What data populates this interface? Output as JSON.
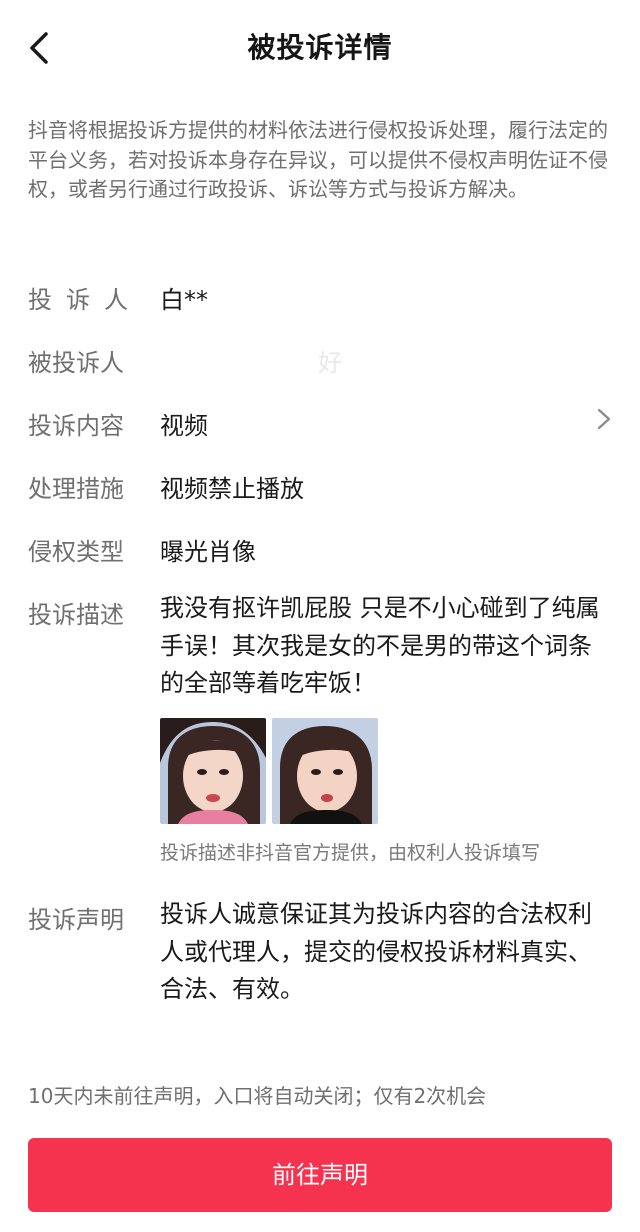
{
  "header": {
    "title": "被投诉详情",
    "back_icon": "chevron-left-icon"
  },
  "notice": "抖音将根据投诉方提供的材料依法进行侵权投诉处理，履行法定的平台义务，若对投诉本身存在异议，可以提供不侵权声明佐证不侵权，或者另行通过行政投诉、诉讼等方式与投诉方解决。",
  "rows": {
    "complainant": {
      "label": "投诉人",
      "value": "白**"
    },
    "respondent": {
      "label": "被投诉人",
      "value": "好"
    },
    "content": {
      "label": "投诉内容",
      "value": "视频"
    },
    "measure": {
      "label": "处理措施",
      "value": "视频禁止播放"
    },
    "type": {
      "label": "侵权类型",
      "value": "曝光肖像"
    },
    "description": {
      "label": "投诉描述",
      "value": "我没有抠许凯屁股 只是不小心碰到了纯属手误！其次我是女的不是男的带这个词条的全部等着吃牢饭！"
    }
  },
  "description_note": "投诉描述非抖音官方提供，由权利人投诉填写",
  "statement": {
    "label": "投诉声明",
    "value": "投诉人诚意保证其为投诉内容的合法权利人或代理人，提交的侵权投诉材料真实、合法、有效。"
  },
  "footer_note": "10天内未前往声明，入口将自动关闭；仅有2次机会",
  "cta_label": "前往声明",
  "colors": {
    "accent": "#f5334f",
    "label": "#707070",
    "text": "#1a1a1a"
  }
}
